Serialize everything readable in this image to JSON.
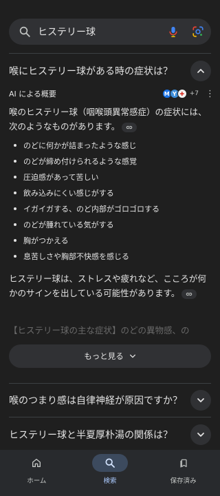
{
  "search": {
    "query": "ヒステリー球"
  },
  "question_open": "喉にヒステリー球がある時の症状は？",
  "ai_overview": {
    "label": "AI による概要",
    "source_count": "+7",
    "intro": "喉のヒステリー球（咽喉頭異常感症）の症状には、次のようなものがあります。",
    "symptoms": [
      "のどに何かが詰まったような感じ",
      "のどが締め付けられるような感覚",
      "圧迫感があって苦しい",
      "飲み込みにくい感じがする",
      "イガイガする、のど内部がゴロゴロする",
      "のどが腫れている気がする",
      "胸がつかえる",
      "息苦しさや胸部不快感を感じる"
    ],
    "summary": "ヒステリー球は、ストレスや疲れなど、こころが何かのサインを出している可能性があります。",
    "faded_text": "【ヒステリー球の主な症状】のどの異物感、の",
    "more_label": "もっと見る"
  },
  "related_questions": [
    "喉のつまり感は自律神経が原因ですか？",
    "ヒステリー球と半夏厚朴湯の関係は？"
  ],
  "bottom_nav": [
    {
      "label": "ホーム",
      "icon": "home-icon"
    },
    {
      "label": "検索",
      "icon": "search-icon",
      "active": true
    },
    {
      "label": "保存済み",
      "icon": "bookmarks-icon"
    }
  ],
  "colors": {
    "background": "#1f1f1f",
    "surface": "#303134",
    "accent": "#a8c7fa"
  }
}
